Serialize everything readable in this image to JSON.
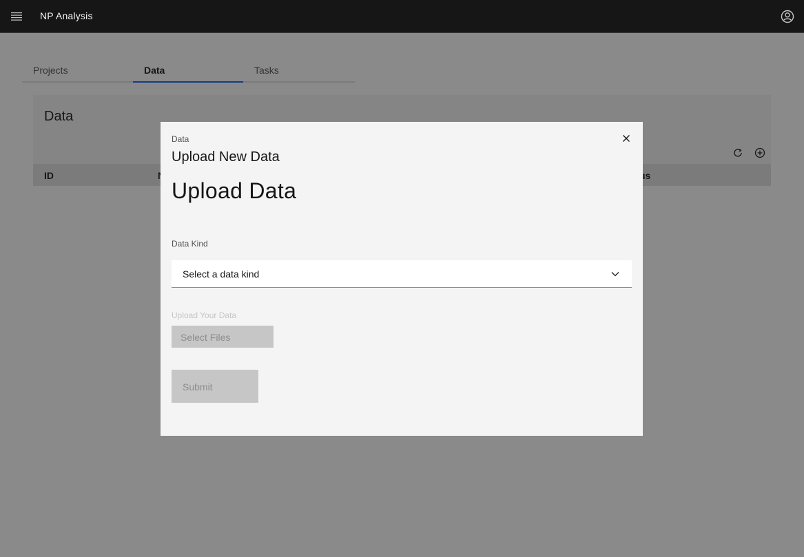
{
  "header": {
    "menu_icon": "hamburger-menu-icon",
    "title": "NP Analysis",
    "user_icon": "user-avatar-icon"
  },
  "tabs": [
    {
      "label": "Projects",
      "active": false
    },
    {
      "label": "Data",
      "active": true
    },
    {
      "label": "Tasks",
      "active": false
    }
  ],
  "card": {
    "title": "Data",
    "toolbar_icons": [
      "refresh-icon",
      "add-icon"
    ],
    "columns": [
      "ID",
      "N",
      "us"
    ]
  },
  "modal": {
    "label": "Data",
    "heading": "Upload New Data",
    "close_icon": "close-icon",
    "form_title": "Upload Data",
    "data_kind_label": "Data Kind",
    "data_kind_value": "Select a data kind",
    "upload_label": "Upload Your Data",
    "select_files_label": "Select Files",
    "submit_label": "Submit"
  },
  "colors": {
    "header_bg": "#161616",
    "accent": "#0f62fe",
    "overlay": "rgba(22,22,22,0.5)",
    "modal_bg": "#f4f4f4",
    "disabled_bg": "#c6c6c6"
  }
}
